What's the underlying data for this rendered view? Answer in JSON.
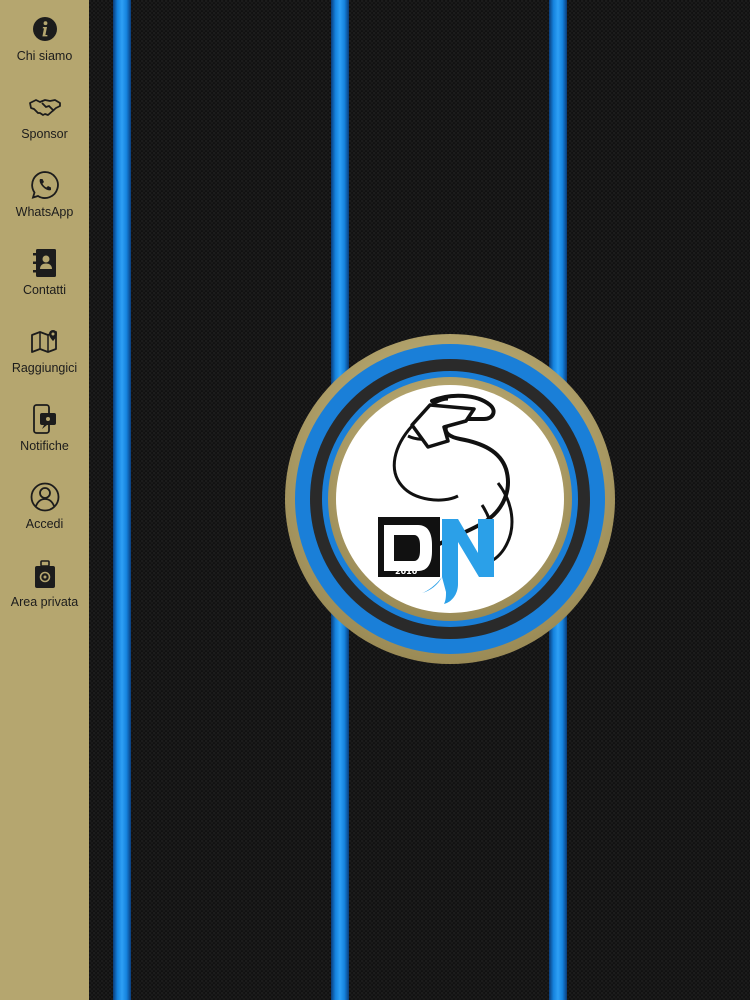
{
  "sidebar": {
    "items": [
      {
        "label": "Chi siamo",
        "icon": "info-icon"
      },
      {
        "label": "Sponsor",
        "icon": "handshake-icon"
      },
      {
        "label": "WhatsApp",
        "icon": "whatsapp-icon"
      },
      {
        "label": "Contatti",
        "icon": "address-book-icon"
      },
      {
        "label": "Raggiungici",
        "icon": "map-pin-icon"
      },
      {
        "label": "Notifiche",
        "icon": "phone-notification-icon"
      },
      {
        "label": "Accedi",
        "icon": "user-circle-icon"
      },
      {
        "label": "Area privata",
        "icon": "private-bag-icon"
      }
    ]
  },
  "logo": {
    "initials": "DN",
    "year": "2010"
  },
  "colors": {
    "sidebar_bg": "#b5a66f",
    "stripe_blue": "#1583de",
    "background": "#111111",
    "gold_ring": "#b3a36d"
  }
}
